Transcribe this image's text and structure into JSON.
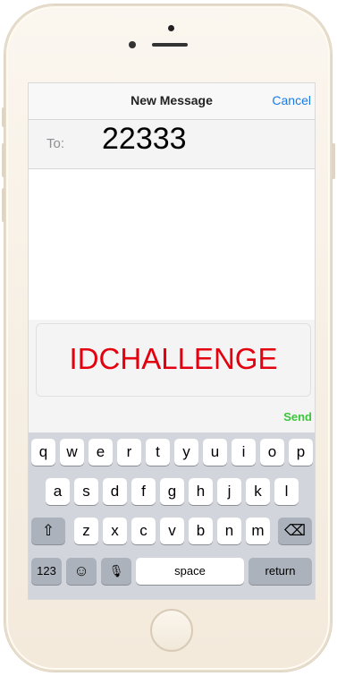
{
  "nav": {
    "title": "New Message",
    "cancel_label": "Cancel"
  },
  "recipient": {
    "label": "To:",
    "value": "22333"
  },
  "compose": {
    "text": "IDCHALLENGE",
    "text_color": "#e3000f"
  },
  "send": {
    "label": "Send",
    "color": "#3bc63b"
  },
  "keyboard": {
    "row1": [
      "q",
      "w",
      "e",
      "r",
      "t",
      "y",
      "u",
      "i",
      "o",
      "p"
    ],
    "row2": [
      "a",
      "s",
      "d",
      "f",
      "g",
      "h",
      "j",
      "k",
      "l"
    ],
    "row3": [
      "z",
      "x",
      "c",
      "v",
      "b",
      "n",
      "m"
    ],
    "shift": "⇧",
    "delete": "⌫",
    "numbers": "123",
    "emoji": "☺",
    "mic": "🎙",
    "space": "space",
    "return": "return"
  },
  "colors": {
    "accent": "#1a7ae5",
    "keyboard_bg": "#d2d5db"
  }
}
